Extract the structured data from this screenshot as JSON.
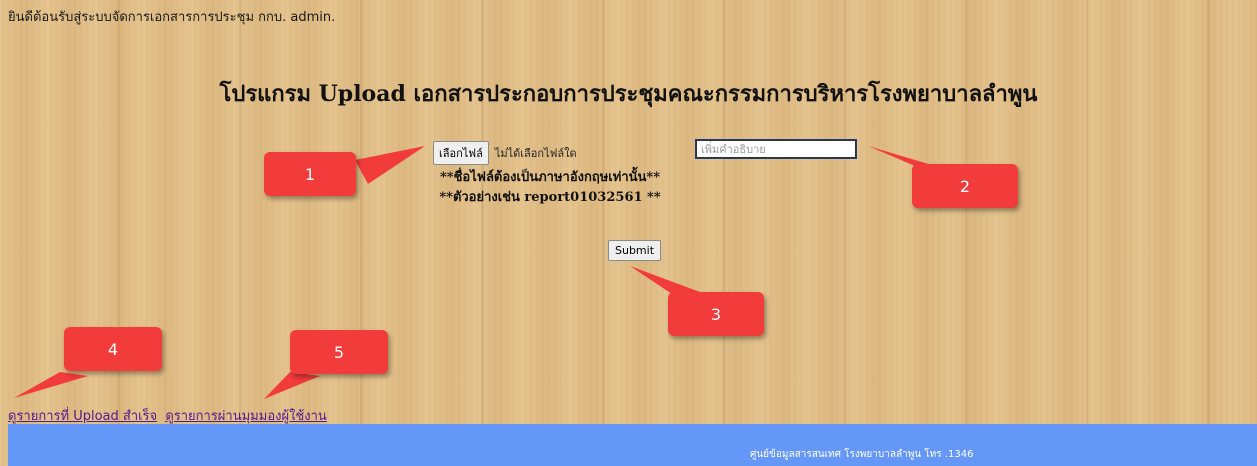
{
  "header": {
    "welcome_text": "ยินดีต้อนรับสู่ระบบจัดการเอกสารการประชุม กกบ. admin."
  },
  "main": {
    "title": "โปรแกรม Upload เอกสารประกอบการประชุมคณะกรรมการบริหารโรงพยาบาลลำพูน",
    "file_button_label": "เลือกไฟล์",
    "file_status": "ไม่ได้เลือกไฟล์ใด",
    "description_placeholder": "เพิ่มคำอธิบาย",
    "note_english_only": "**ชื่อไฟล์ต้องเป็นภาษาอังกฤษเท่านั้น**",
    "note_example": "**ตัวอย่างเช่น report01032561 **",
    "submit_label": "Submit"
  },
  "callouts": [
    "1",
    "2",
    "3",
    "4",
    "5"
  ],
  "links": {
    "uploaded_list": "ดูรายการที่ Upload สำเร็จ",
    "user_view": "ดูรายการผ่านมุมมองผู้ใช้งาน"
  },
  "footer": {
    "text": "ศูนย์ข้อมูลสารสนเทศ โรงพยาบาลลำพูน โทร .1346"
  },
  "colors": {
    "callout": "#f23b3b",
    "footer_bg": "#6497f7",
    "link": "#551a8b"
  }
}
